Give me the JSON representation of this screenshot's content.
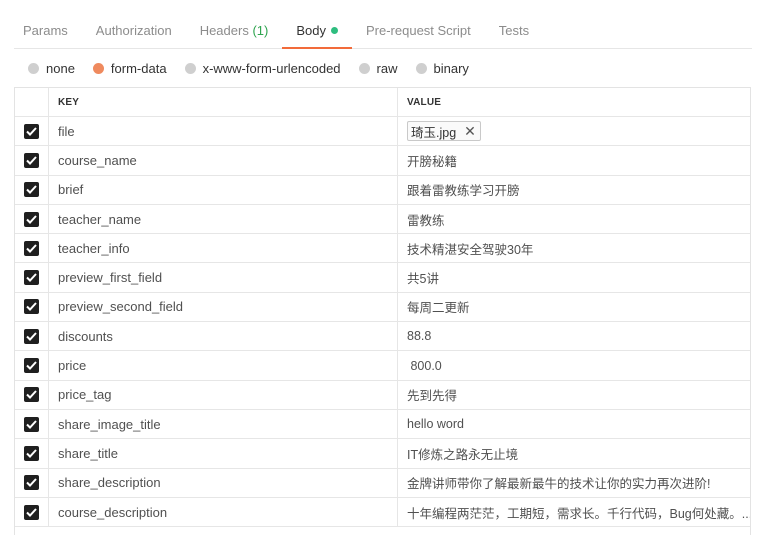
{
  "tabs": [
    {
      "label": "Params"
    },
    {
      "label": "Authorization"
    },
    {
      "label": "Headers",
      "count": "(1)"
    },
    {
      "label": "Body"
    },
    {
      "label": "Pre-request Script"
    },
    {
      "label": "Tests"
    }
  ],
  "active_tab": "Body",
  "body_types": [
    "none",
    "form-data",
    "x-www-form-urlencoded",
    "raw",
    "binary"
  ],
  "selected_body_type": "form-data",
  "table": {
    "key_header": "KEY",
    "value_header": "VALUE",
    "rows": [
      {
        "key": "file",
        "value": "琦玉.jpg",
        "type": "file",
        "checked": true
      },
      {
        "key": "course_name",
        "value": "开膀秘籍",
        "checked": true
      },
      {
        "key": "brief",
        "value": "跟着雷教练学习开膀",
        "checked": true
      },
      {
        "key": "teacher_name",
        "value": "雷教练",
        "checked": true
      },
      {
        "key": "teacher_info",
        "value": "技术精湛安全驾驶30年",
        "checked": true
      },
      {
        "key": "preview_first_field",
        "value": "共5讲",
        "checked": true
      },
      {
        "key": "preview_second_field",
        "value": "每周二更新",
        "checked": true
      },
      {
        "key": "discounts",
        "value": "88.8",
        "checked": true
      },
      {
        "key": "price",
        "value": " 800.0",
        "checked": true
      },
      {
        "key": "price_tag",
        "value": "先到先得",
        "checked": true
      },
      {
        "key": "share_image_title",
        "value": "hello word",
        "checked": true
      },
      {
        "key": "share_title",
        "value": "IT修炼之路永无止境",
        "checked": true
      },
      {
        "key": "share_description",
        "value": "金牌讲师带你了解最新最牛的技术让你的实力再次进阶!",
        "checked": true
      },
      {
        "key": "course_description",
        "value": "十年编程两茫茫，工期短，需求长。千行代码，Bug何处藏。...",
        "checked": true
      }
    ]
  },
  "colors": {
    "accent": "#f26b3a",
    "radio_selected": "#ef8a5e",
    "headers_count": "#2ea44f",
    "body_dot": "#2ebd7f"
  }
}
